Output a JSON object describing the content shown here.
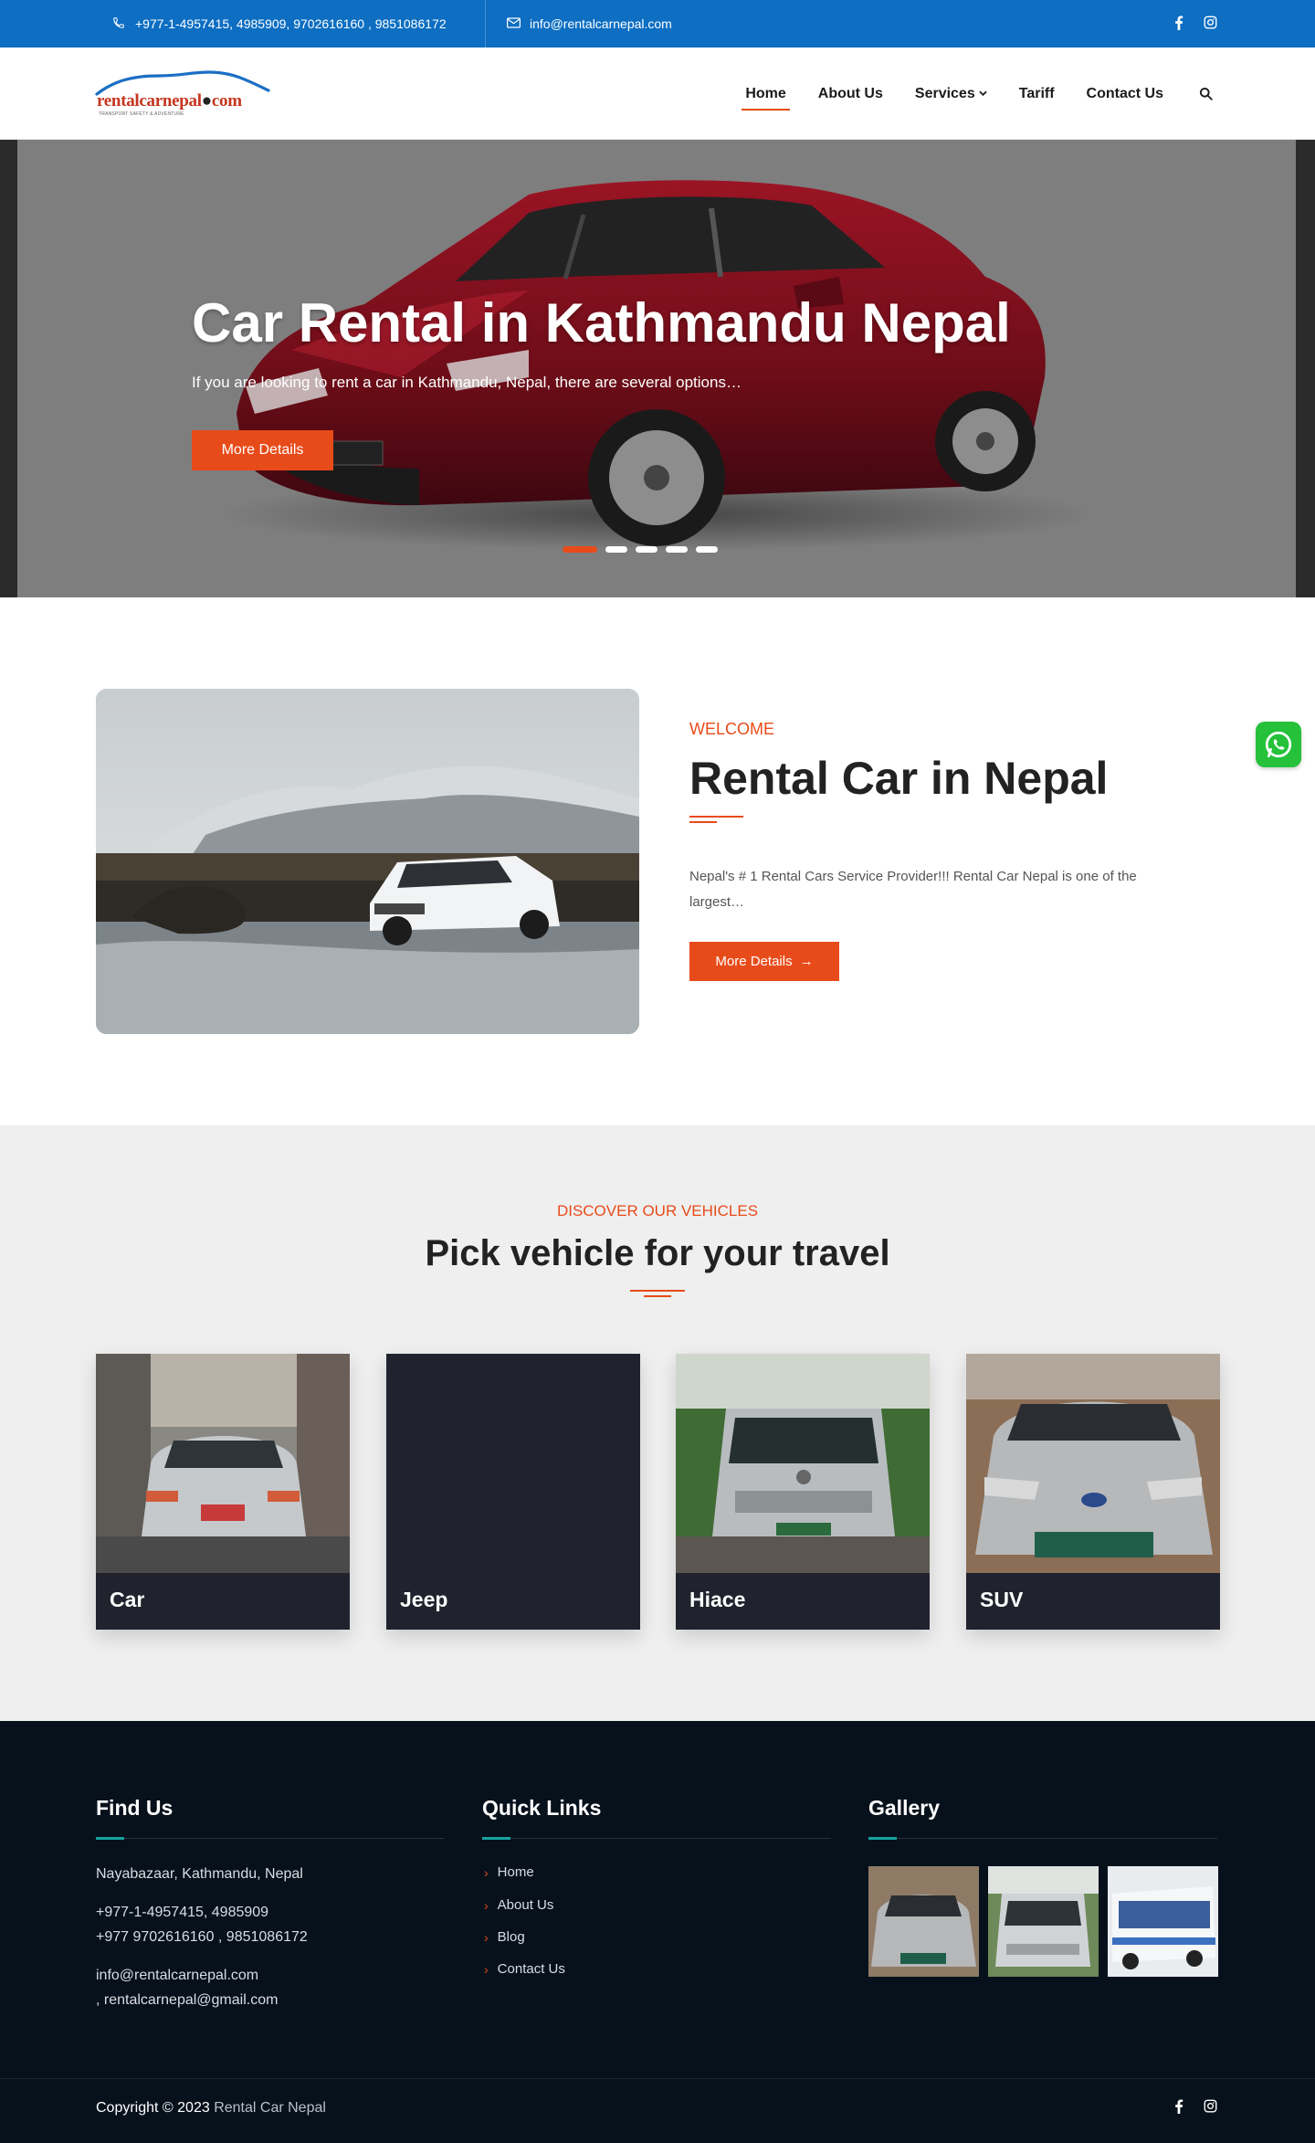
{
  "topbar": {
    "phone": "+977-1-4957415, 4985909, 9702616160 , 9851086172",
    "email": "info@rentalcarnepal.com",
    "social": [
      "facebook-icon",
      "instagram-icon"
    ]
  },
  "logo": {
    "brand": "rentalcarnepal",
    "suffix": "com",
    "tagline": "TRANSPORT SAFETY & ADVENTURE"
  },
  "nav": {
    "items": [
      "Home",
      "About Us",
      "Services",
      "Tariff",
      "Contact Us"
    ],
    "active": "Home"
  },
  "hero": {
    "title": "Car Rental in Kathmandu Nepal",
    "subtitle": "If you are looking to rent a car in Kathmandu, Nepal, there are several options…",
    "button": "More Details",
    "slides": 5,
    "active_slide": 1
  },
  "welcome": {
    "kicker": "WELCOME",
    "title": "Rental Car in Nepal",
    "text": "Nepal's # 1 Rental Cars Service Provider!!! Rental Car Nepal is one of the largest…",
    "button": "More Details",
    "button_arrow": "→"
  },
  "vehicles": {
    "kicker": "DISCOVER OUR VEHICLES",
    "title": "Pick vehicle for your travel",
    "cards": [
      {
        "label": "Car"
      },
      {
        "label": "Jeep"
      },
      {
        "label": "Hiace"
      },
      {
        "label": "SUV"
      }
    ]
  },
  "footer": {
    "find_us": {
      "title": "Find Us",
      "address": "Nayabazaar, Kathmandu, Nepal",
      "phone1": "+977-1-4957415, 4985909",
      "phone2": "+977 9702616160 , 9851086172",
      "email1": "info@rentalcarnepal.com",
      "email2": ", rentalcarnepal@gmail.com"
    },
    "quick_links": {
      "title": "Quick Links",
      "items": [
        "Home",
        "About Us",
        "Blog",
        "Contact Us"
      ]
    },
    "gallery": {
      "title": "Gallery"
    }
  },
  "copyright": {
    "text": "Copyright © 2023",
    "brand": "Rental Car Nepal"
  },
  "colors": {
    "topbar": "#0d6ec2",
    "accent": "#e84b1a",
    "footer": "#07111c",
    "footer_accent": "#16a3a0"
  }
}
